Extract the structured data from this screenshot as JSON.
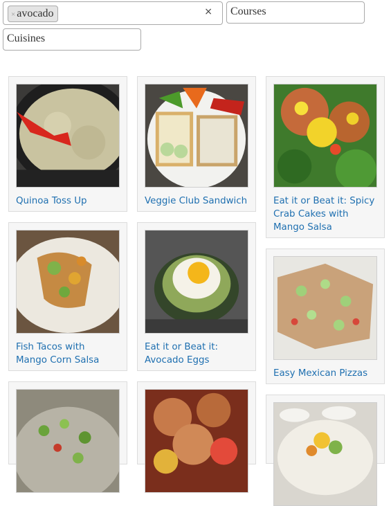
{
  "filters": {
    "ingredients_token": "avocado",
    "token_remove_glyph": "×",
    "clear_glyph": "×",
    "courses_placeholder": "Courses",
    "cuisines_placeholder": "Cuisines"
  },
  "recipes": [
    {
      "title": "Quinoa Toss Up",
      "image": "quinoa-photo"
    },
    {
      "title": "Veggie Club Sandwich",
      "image": "sandwich-photo"
    },
    {
      "title": "Eat it or Beat it: Spicy\nCrab Cakes with\nMango Salsa",
      "image": "crab-cakes-photo"
    },
    {
      "title": "Fish Tacos with\nMango Corn Salsa",
      "image": "fish-tacos-photo"
    },
    {
      "title": "Eat it or Beat it:\nAvocado Eggs",
      "image": "avocado-eggs-photo"
    },
    {
      "title": "Easy Mexican Pizzas",
      "image": "mexican-pizza-photo"
    },
    {
      "title": "",
      "image": "salad-photo"
    },
    {
      "title": "",
      "image": "chicken-bowl-photo"
    },
    {
      "title": "",
      "image": "tacos-photo"
    }
  ]
}
